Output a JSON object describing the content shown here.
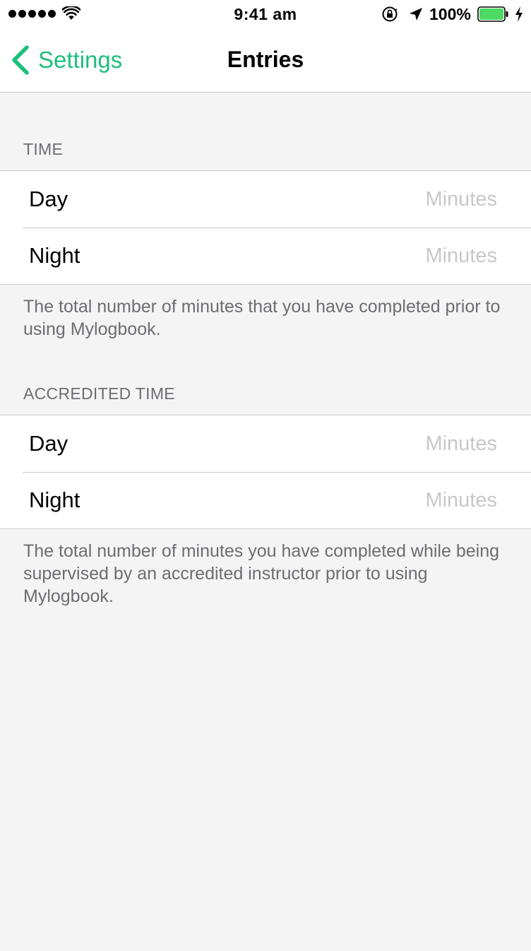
{
  "status_bar": {
    "time": "9:41 am",
    "battery_percent": "100%",
    "signal_bars": 5,
    "battery_color": "#4cd964"
  },
  "nav": {
    "back_label": "Settings",
    "title": "Entries",
    "accent_color": "#1fbe7c"
  },
  "sections": [
    {
      "header": "TIME",
      "rows": [
        {
          "label": "Day",
          "placeholder": "Minutes",
          "value": ""
        },
        {
          "label": "Night",
          "placeholder": "Minutes",
          "value": ""
        }
      ],
      "footer": "The total number of minutes that you have completed prior to using Mylogbook."
    },
    {
      "header": "ACCREDITED TIME",
      "rows": [
        {
          "label": "Day",
          "placeholder": "Minutes",
          "value": ""
        },
        {
          "label": "Night",
          "placeholder": "Minutes",
          "value": ""
        }
      ],
      "footer": "The total number of minutes you have completed while being supervised by an accredited instructor prior to using Mylogbook."
    }
  ]
}
